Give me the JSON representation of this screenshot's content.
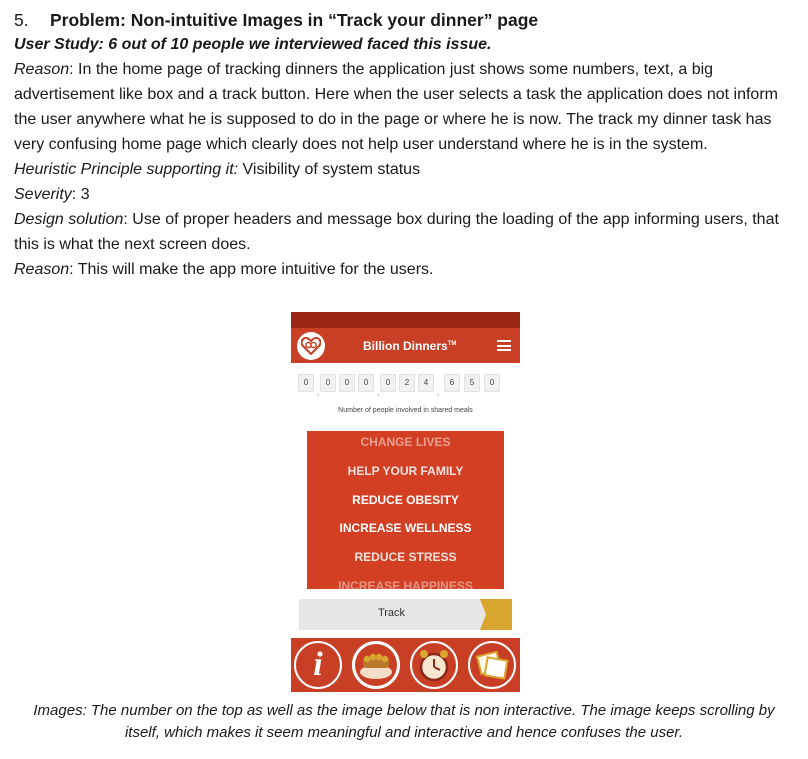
{
  "document": {
    "number": "5.",
    "heading": "Problem: Non-intuitive Images in “Track your dinner” page",
    "user_study": "User Study: 6 out of 10 people we interviewed faced this issue.",
    "reason1_label": "Reason",
    "reason1_text": ": In the home page of tracking dinners the application just shows some numbers, text, a big advertisement like box and a track button. Here when the user selects a task the application does not inform the user anywhere what he is supposed to do in the page or where he is now. The track my dinner task has very confusing home page which clearly does not help user understand where he is in the system.",
    "heuristic_label": "Heuristic Principle supporting it:",
    "heuristic_text": " Visibility of system status",
    "severity_label": "Severity",
    "severity_text": ": 3",
    "design_label": "Design solution",
    "design_text": ": Use of proper headers and message box during the loading of the app informing users, that this is what the next screen does.",
    "reason2_label": "Reason",
    "reason2_text": ": This will make the app more intuitive for the users.",
    "caption": "Images: The number on the top as well as the image below that is non interactive. The image keeps scrolling by itself, which makes it seem meaningful and interactive and hence confuses the user."
  },
  "screenshot": {
    "app_title": "Billion Dinners",
    "trademark": "TM",
    "counter_digits": [
      "0",
      "0",
      "0",
      "0",
      "0",
      "2",
      "4",
      "6",
      "5",
      "0"
    ],
    "counter_caption": "Number of people involved in shared meals",
    "ad_lines": [
      "CHANGE LIVES",
      "HELP YOUR FAMILY",
      "REDUCE OBESITY",
      "INCREASE WELLNESS",
      "REDUCE STRESS",
      "INCREASE HAPPINESS"
    ],
    "track_label": "Track",
    "info_glyph": "i",
    "colors": {
      "brand_red": "#c93f25",
      "dark_red": "#9b2615",
      "gold": "#d9a630"
    }
  }
}
